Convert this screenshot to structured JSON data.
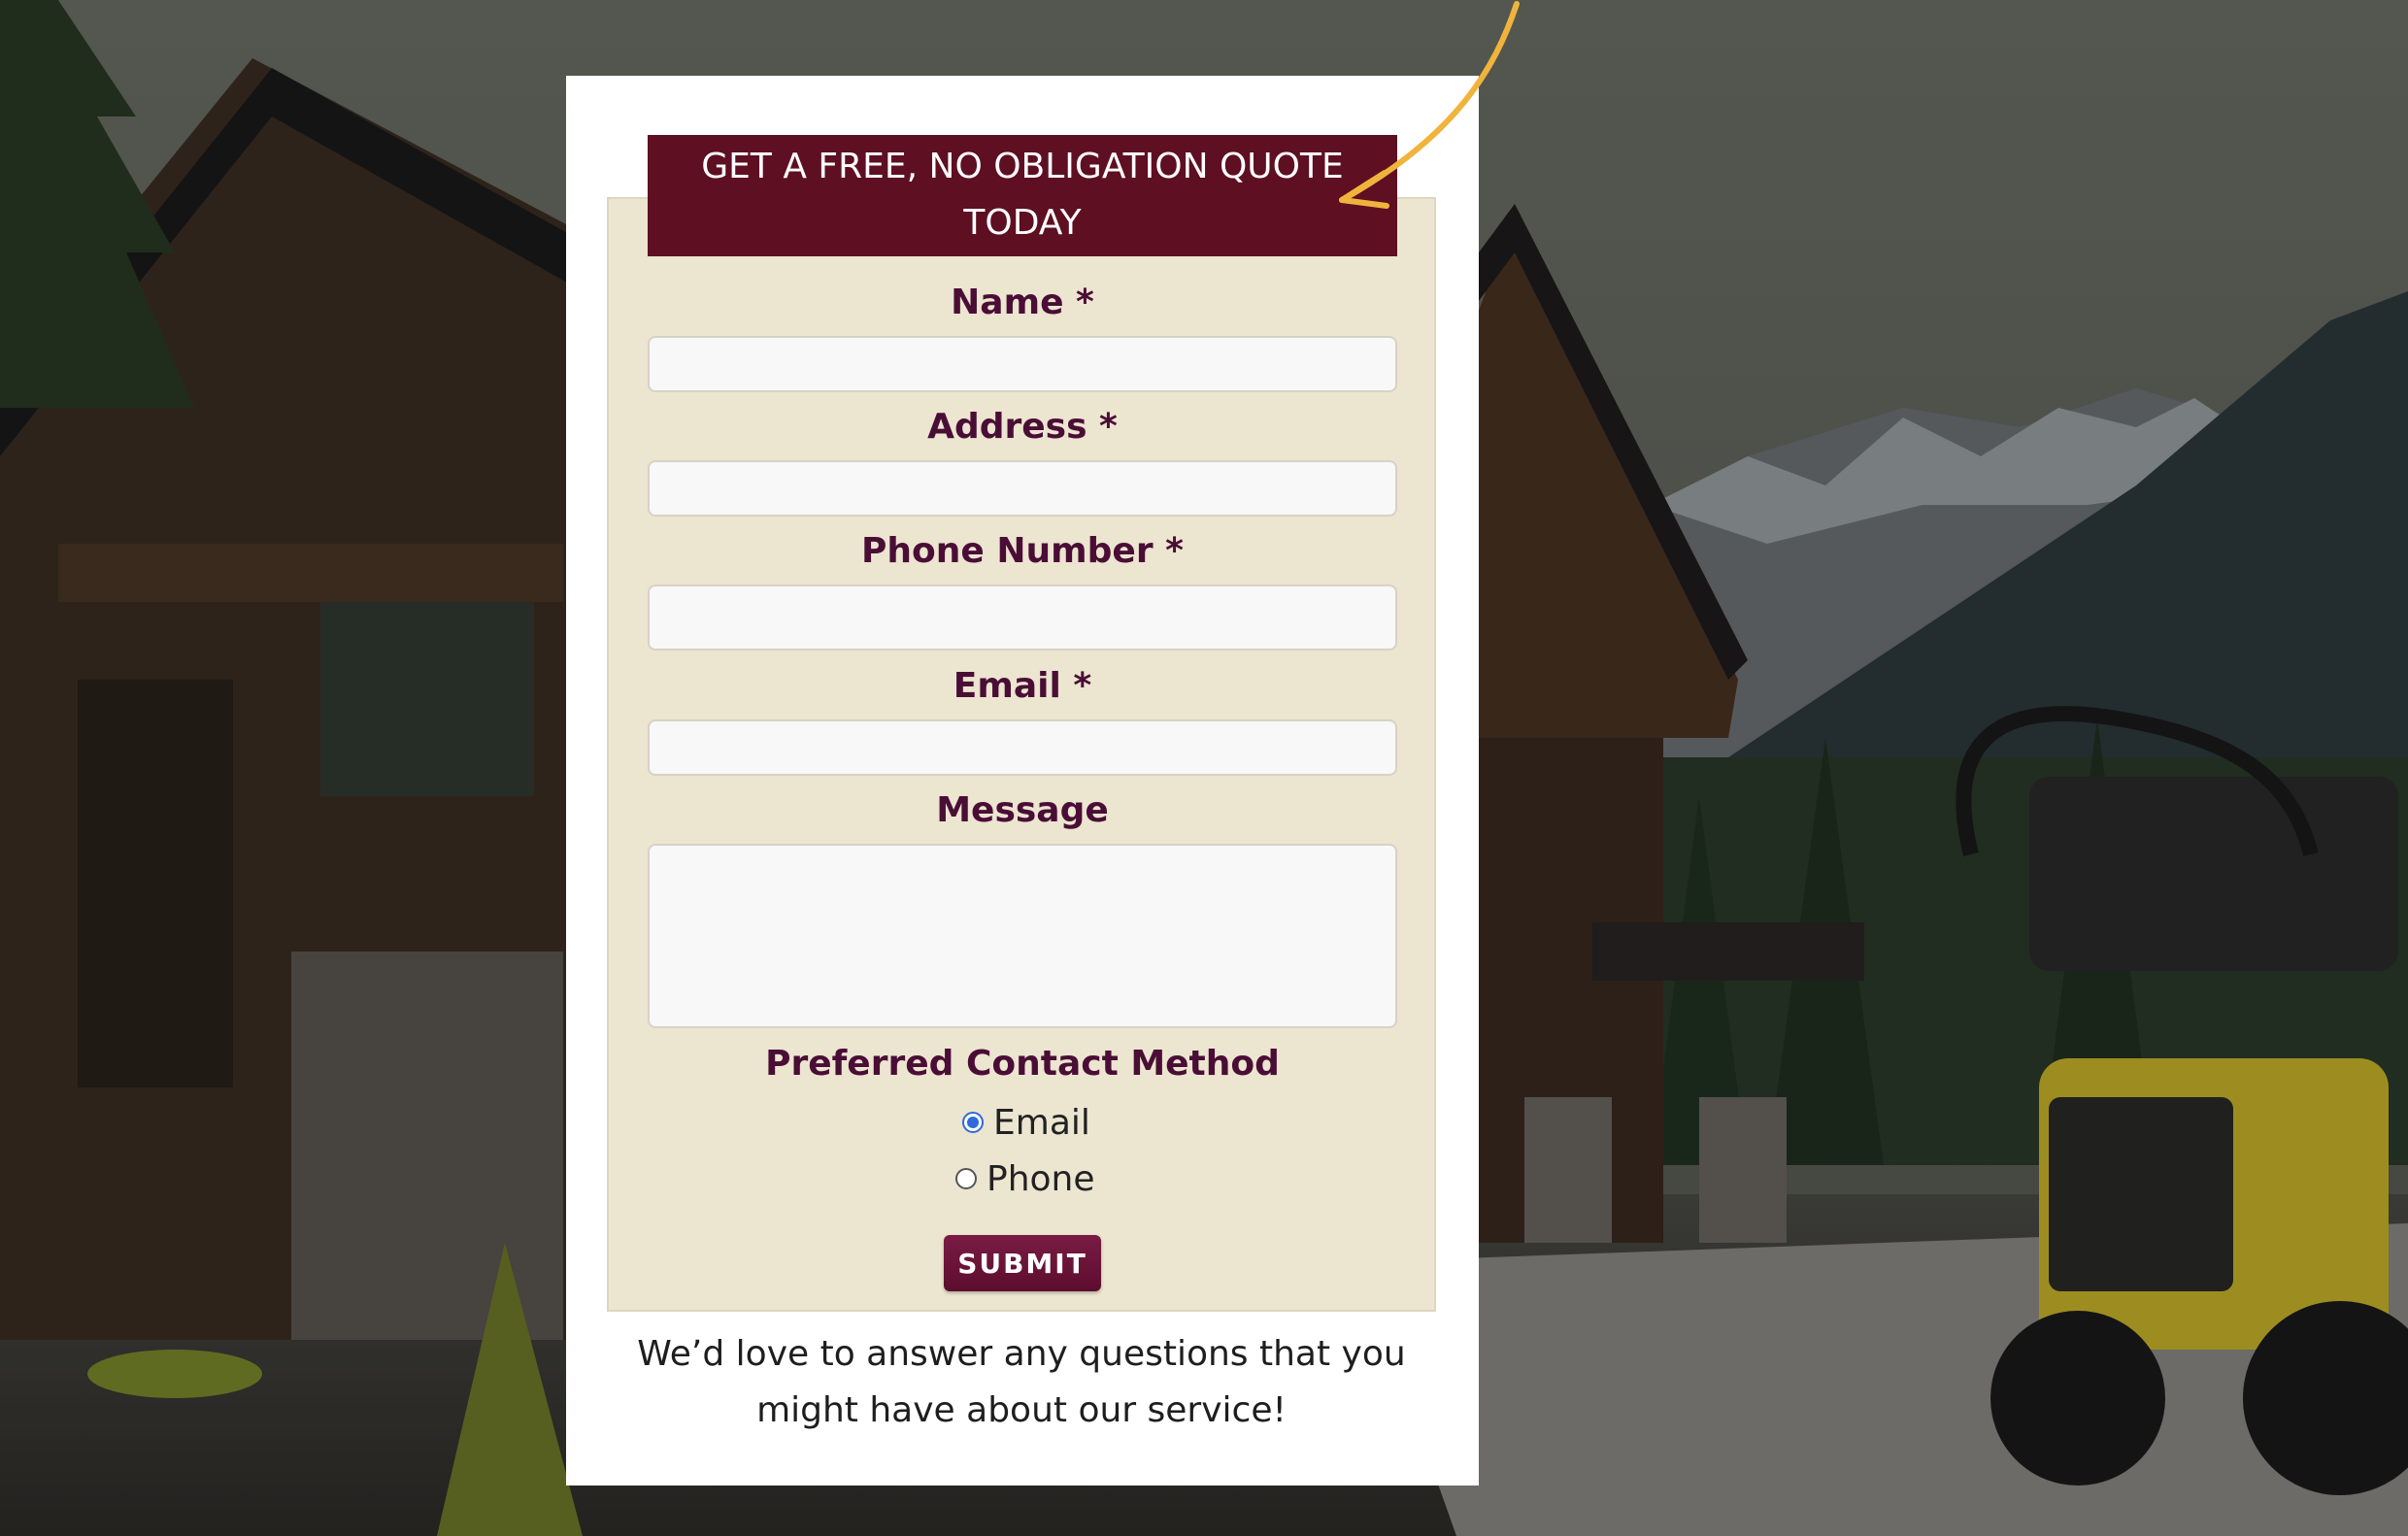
{
  "quote_form": {
    "banner": "GET A FREE, NO OBLIGATION QUOTE TODAY",
    "fields": {
      "name_label": "Name *",
      "address_label": "Address *",
      "phone_label": "Phone Number *",
      "email_label": "Email *",
      "message_label": "Message"
    },
    "contact_method": {
      "label": "Preferred Contact Method",
      "options": [
        "Email",
        "Phone"
      ],
      "selected": "Email"
    },
    "submit_label": "SUBMIT",
    "footer": "We’d love to answer any questions that you might have about our service!"
  },
  "colors": {
    "banner_bg": "#5e0f22",
    "label_color": "#4a0e36",
    "panel_bg": "#ece5d0",
    "arrow": "#f0b43c"
  },
  "icons": {
    "arrow": "curved-arrow-icon"
  }
}
